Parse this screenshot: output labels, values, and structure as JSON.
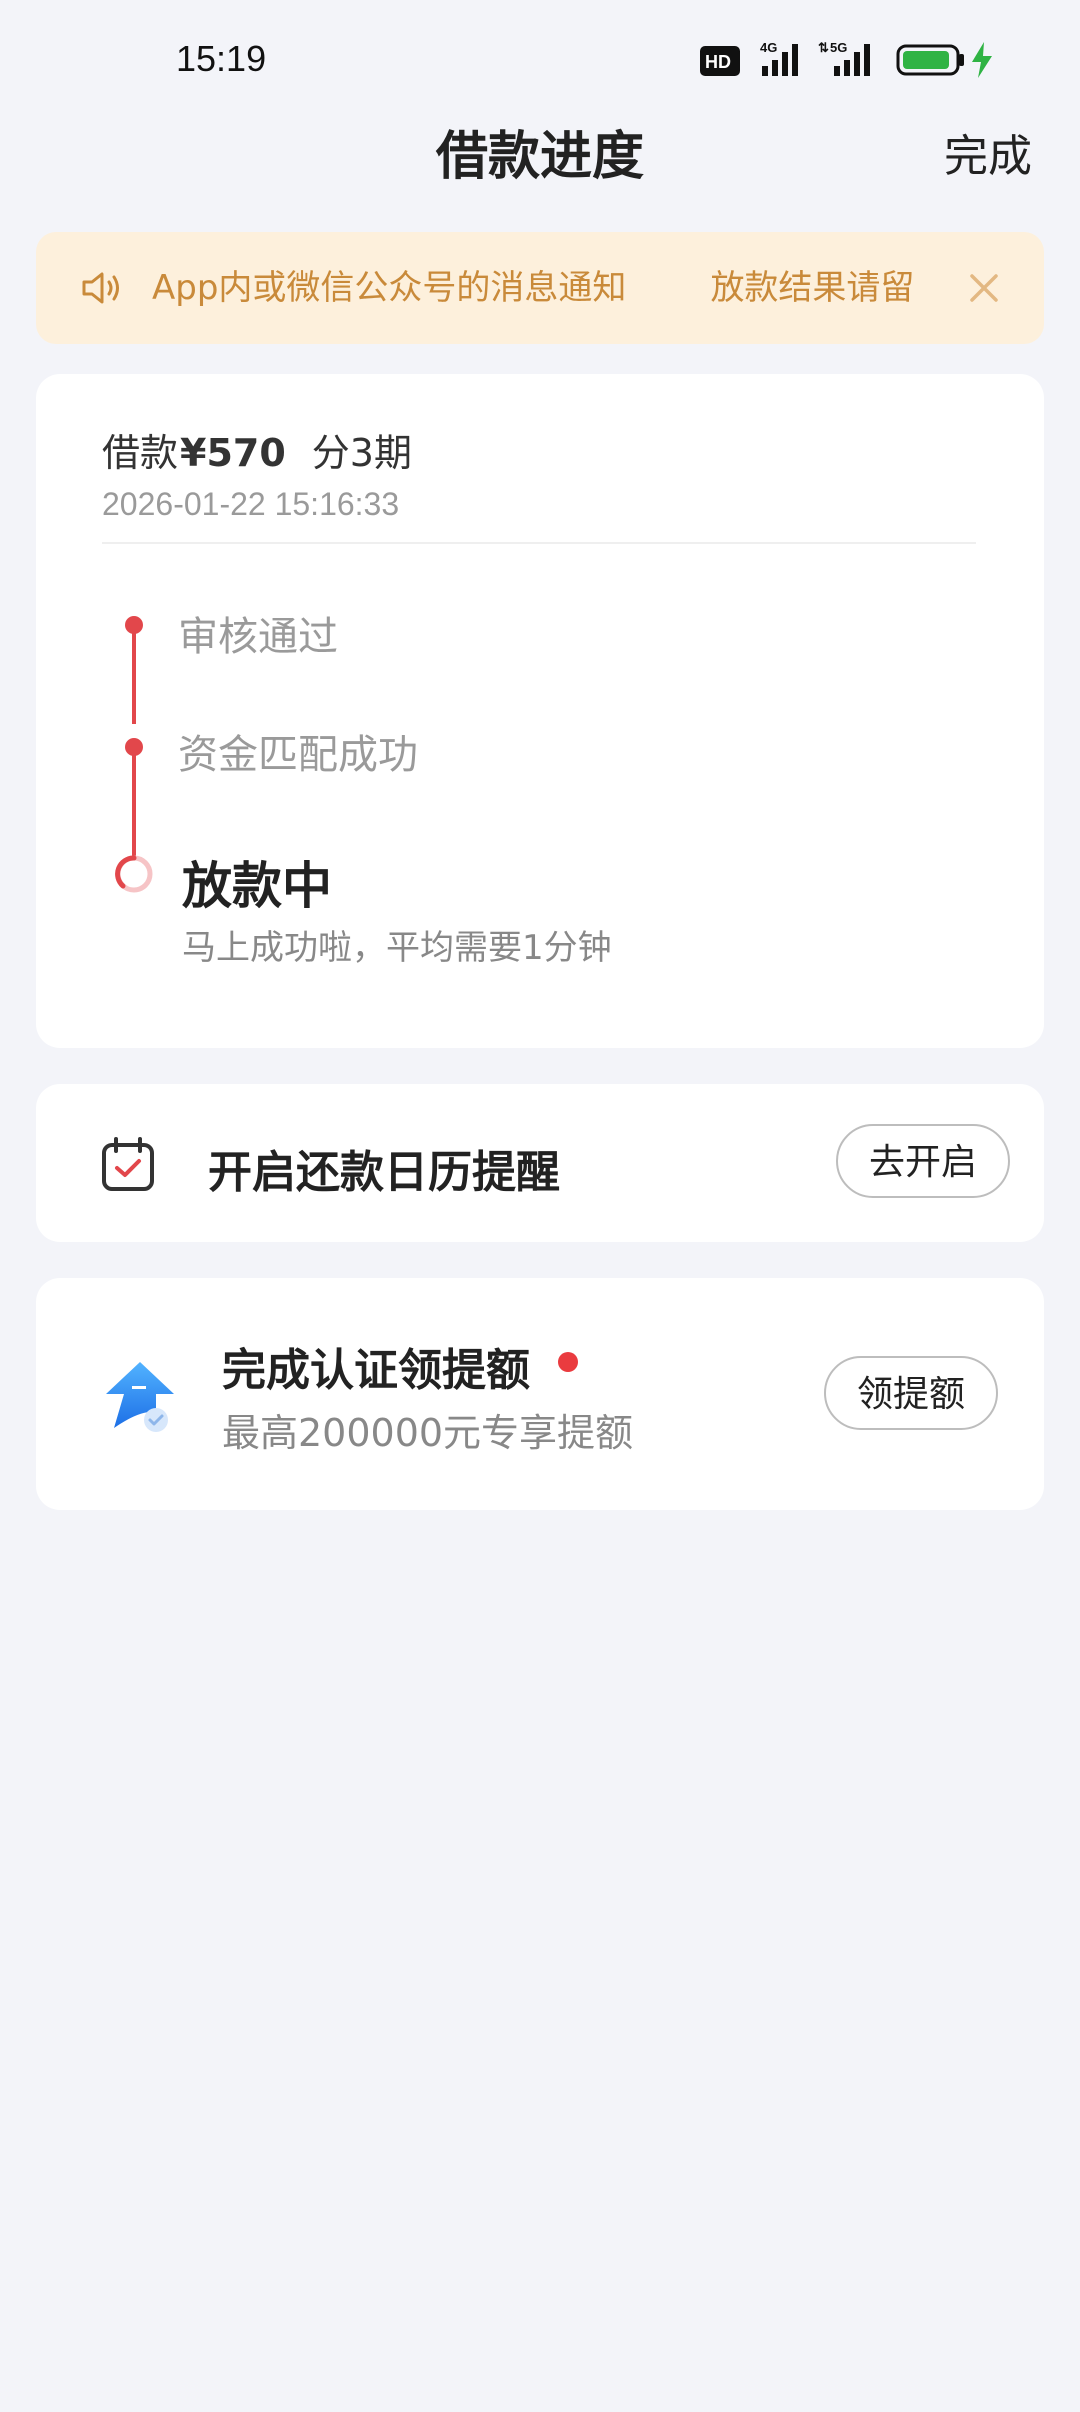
{
  "status_bar": {
    "time": "15:19",
    "hd_label": "HD",
    "network_4g": "4G",
    "network_5g": "5G",
    "battery_color": "#2fb344",
    "charging_color": "#2fb344"
  },
  "header": {
    "title": "借款进度",
    "done_label": "完成"
  },
  "notice": {
    "icon": "speaker-icon",
    "text": "App内或微信公众号的消息通知",
    "text_2": "放款结果请留",
    "close_icon": "close-icon",
    "accent": "#c98a3a",
    "background": "#fdf0dc"
  },
  "loan": {
    "label": "借款",
    "amount": "¥570",
    "periods": "分3期",
    "time": "2026-01-22 15:16:33",
    "accent": "#e2474b",
    "steps": [
      {
        "label": "审核通过",
        "done": true
      },
      {
        "label": "资金匹配成功",
        "done": true
      }
    ],
    "current": {
      "label": "放款中",
      "sub": "马上成功啦，平均需要1分钟"
    }
  },
  "reminder": {
    "icon": "calendar-check-icon",
    "text": "开启还款日历提醒",
    "button": "去开启"
  },
  "credit": {
    "icon": "credit-raise-icon",
    "title": "完成认证领提额",
    "sub": "最高200000元专享提额",
    "button": "领提额"
  }
}
